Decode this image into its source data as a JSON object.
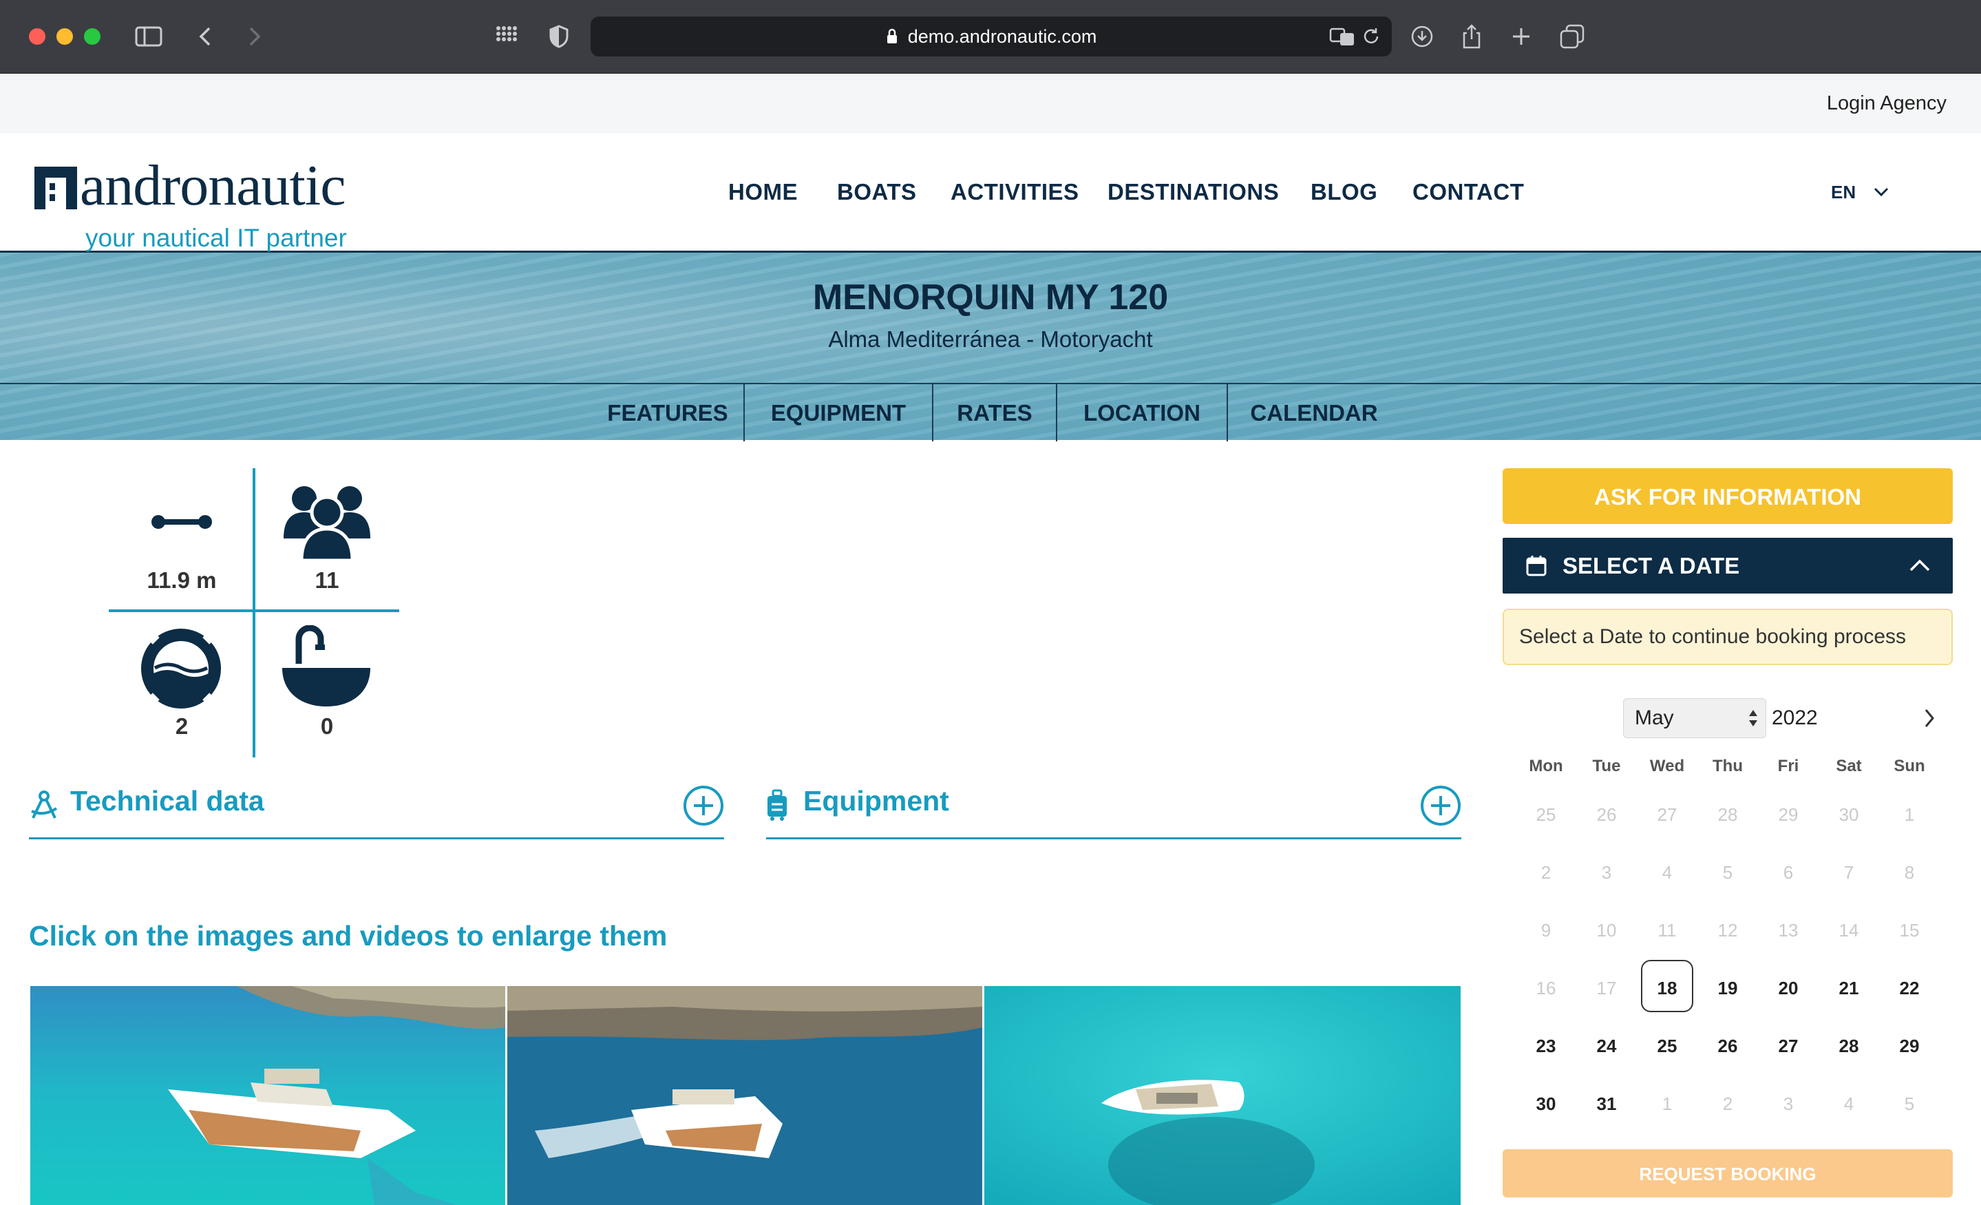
{
  "browser": {
    "url": "demo.andronautic.com"
  },
  "topbar": {
    "login": "Login Agency"
  },
  "header": {
    "logo_word": "andronautic",
    "tagline": "your nautical IT partner",
    "nav": [
      "HOME",
      "BOATS",
      "ACTIVITIES",
      "DESTINATIONS",
      "BLOG",
      "CONTACT"
    ],
    "language": "EN"
  },
  "hero": {
    "title": "MENORQUIN MY 120",
    "subtitle": "Alma Mediterránea - Motoryacht",
    "tabs": [
      "FEATURES",
      "EQUIPMENT",
      "RATES",
      "LOCATION",
      "CALENDAR"
    ]
  },
  "specs": {
    "length": "11.9 m",
    "guests": "11",
    "cabins": "2",
    "bathrooms": "0"
  },
  "sections": {
    "technical": "Technical data",
    "equipment": "Equipment",
    "gallery_hint": "Click on the images and videos to enlarge them"
  },
  "sidebar": {
    "ask_button": "ASK FOR INFORMATION",
    "select_date": "SELECT A DATE",
    "notice": "Select a Date to continue booking process",
    "month": "May",
    "year": "2022",
    "request_button": "REQUEST BOOKING"
  },
  "calendar": {
    "weekdays": [
      "Mon",
      "Tue",
      "Wed",
      "Thu",
      "Fri",
      "Sat",
      "Sun"
    ],
    "weeks": [
      [
        "25",
        "26",
        "27",
        "28",
        "29",
        "30",
        "1"
      ],
      [
        "2",
        "3",
        "4",
        "5",
        "6",
        "7",
        "8"
      ],
      [
        "9",
        "10",
        "11",
        "12",
        "13",
        "14",
        "15"
      ],
      [
        "16",
        "17",
        "18",
        "19",
        "20",
        "21",
        "22"
      ],
      [
        "23",
        "24",
        "25",
        "26",
        "27",
        "28",
        "29"
      ],
      [
        "30",
        "31",
        "1",
        "2",
        "3",
        "4",
        "5"
      ]
    ],
    "selected_day": "18"
  },
  "colors": {
    "navy": "#0d2c45",
    "accent_teal": "#189bbf",
    "ask_yellow": "#f6c22e",
    "request_orange": "#fbc98b",
    "notice_bg": "#fdf4d6"
  }
}
